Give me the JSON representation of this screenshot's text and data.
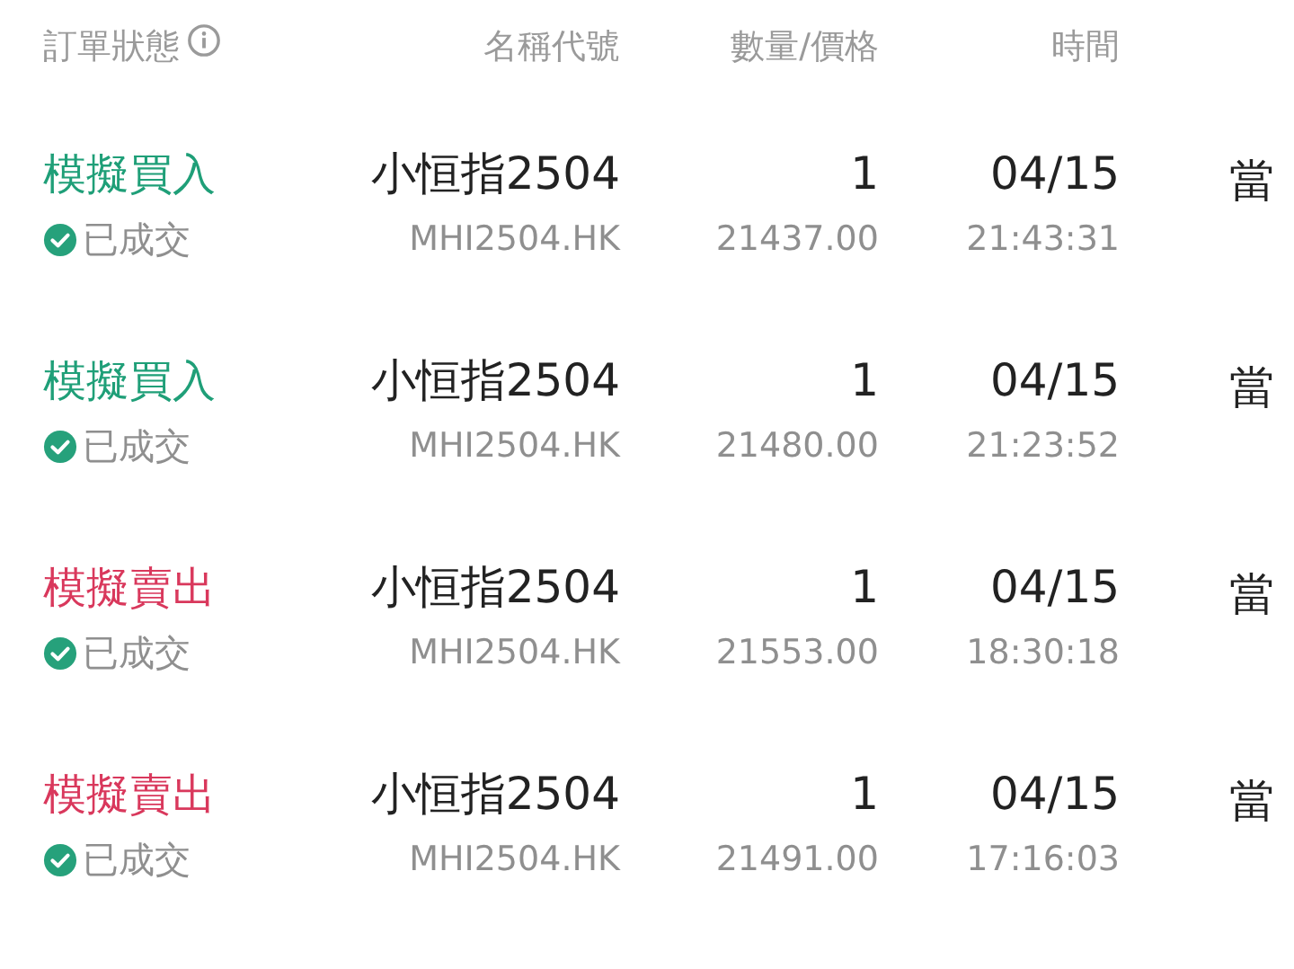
{
  "header": {
    "columns": [
      "訂單狀態",
      "名稱代號",
      "數量/價格",
      "時間"
    ]
  },
  "orders": [
    {
      "side": "模擬買入",
      "kind": "buy",
      "status": "已成交",
      "name": "小恒指2504",
      "code": "MHI2504.HK",
      "quantity": "1",
      "price": "21437.00",
      "date": "04/15",
      "time": "21:43:31",
      "column_5": "當"
    },
    {
      "side": "模擬買入",
      "kind": "buy",
      "status": "已成交",
      "name": "小恒指2504",
      "code": "MHI2504.HK",
      "quantity": "1",
      "price": "21480.00",
      "date": "04/15",
      "time": "21:23:52",
      "column_5": "當"
    },
    {
      "side": "模擬賣出",
      "kind": "sell",
      "status": "已成交",
      "name": "小恒指2504",
      "code": "MHI2504.HK",
      "quantity": "1",
      "price": "21553.00",
      "date": "04/15",
      "time": "18:30:18",
      "column_5": "當"
    },
    {
      "side": "模擬賣出",
      "kind": "sell",
      "status": "已成交",
      "name": "小恒指2504",
      "code": "MHI2504.HK",
      "quantity": "1",
      "price": "21491.00",
      "date": "04/15",
      "time": "17:16:03",
      "column_5": "當"
    }
  ]
}
